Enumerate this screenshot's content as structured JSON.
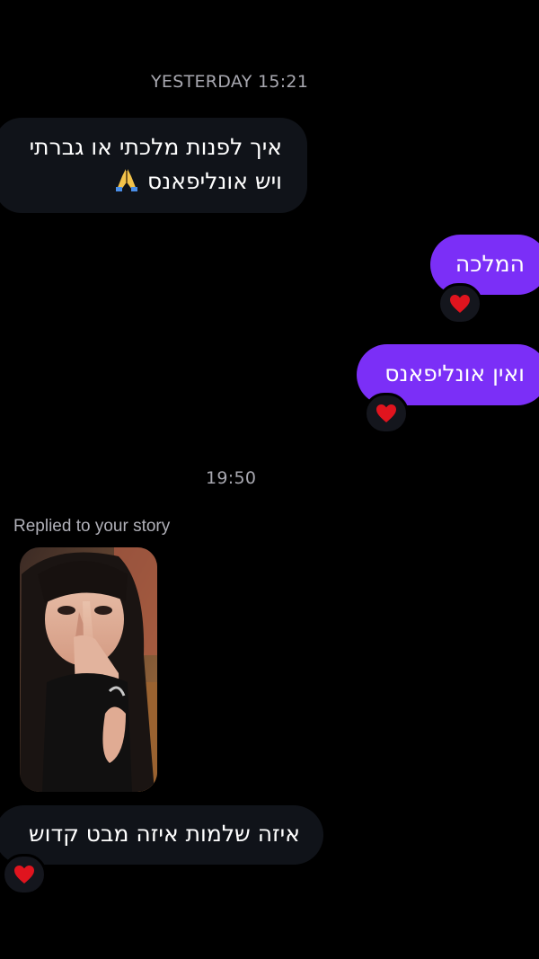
{
  "timestamps": {
    "first": "YESTERDAY 15:21",
    "second": "19:50"
  },
  "messages": [
    {
      "direction": "incoming",
      "lines": [
        "איך לפנות מלכתי או גברתי",
        "ויש אונליפאנס"
      ],
      "trailing_icon": "folded-hands-emoji"
    },
    {
      "direction": "outgoing",
      "text": "המלכה",
      "reaction": "red-heart-emoji"
    },
    {
      "direction": "outgoing",
      "text": "ואין אונליפאנס",
      "reaction": "red-heart-emoji"
    },
    {
      "direction": "incoming",
      "text": "איזה שלמות איזה מבט קדוש",
      "reaction": "red-heart-emoji"
    }
  ],
  "story_reply": {
    "label": "Replied to your story"
  },
  "colors": {
    "background": "#000000",
    "incoming_bubble": "#101319",
    "outgoing_bubble": "#7b2ff7",
    "timestamp": "#a8a8b0",
    "heart": "#e0141e"
  }
}
